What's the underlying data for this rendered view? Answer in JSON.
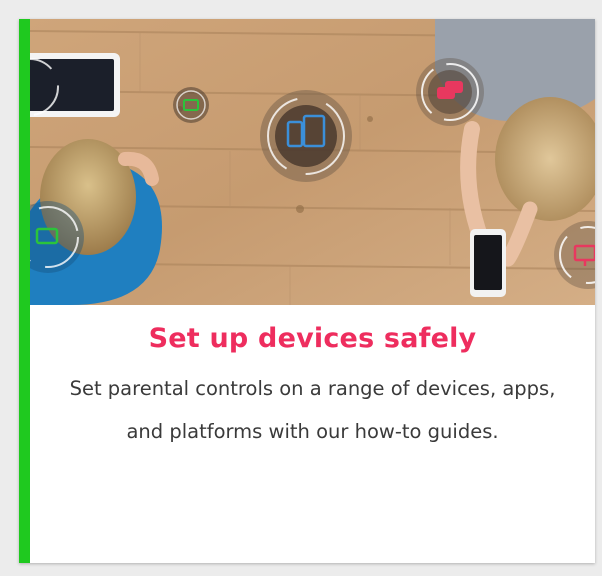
{
  "card": {
    "title": "Set up devices safely",
    "description": "Set parental controls on a range of devices, apps, and platforms with our how-to guides.",
    "image": {
      "icons": [
        "tablet-and-phone-icon",
        "tv-icon",
        "chat-bubbles-icon",
        "monitor-icon",
        "game-controller-icon"
      ]
    }
  },
  "colors": {
    "accent_green": "#1fc91f",
    "title_pink": "#ee2d5e",
    "icon_blue": "#3b8fd9",
    "icon_red": "#e8385f",
    "icon_green": "#2bc43b"
  }
}
